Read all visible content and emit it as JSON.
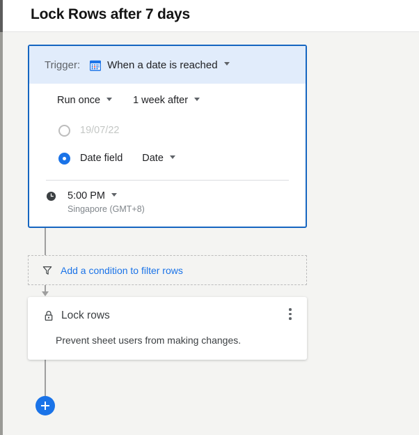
{
  "page": {
    "title": "Lock Rows after 7 days"
  },
  "trigger": {
    "label": "Trigger:",
    "icon": "calendar-icon",
    "value": "When a date is reached",
    "frequency": "Run once",
    "offset": "1 week after",
    "date_option": {
      "value": "19/07/22",
      "selected": false
    },
    "date_field_option": {
      "label": "Date field",
      "field": "Date",
      "selected": true
    },
    "time": {
      "icon": "clock-icon",
      "value": "5:00 PM",
      "timezone": "Singapore (GMT+8)"
    }
  },
  "condition": {
    "icon": "filter-icon",
    "label": "Add a condition to filter rows"
  },
  "action": {
    "icon": "lock-icon",
    "title": "Lock rows",
    "description": "Prevent sheet users from making changes.",
    "menu_icon": "more-vertical-icon"
  },
  "add_step": {
    "icon": "plus-icon"
  },
  "colors": {
    "accent": "#1a73e8",
    "trigger_border": "#1565c0",
    "trigger_header_bg": "#e1ecfb",
    "canvas_bg": "#f4f4f2",
    "muted_text": "#80868b"
  }
}
